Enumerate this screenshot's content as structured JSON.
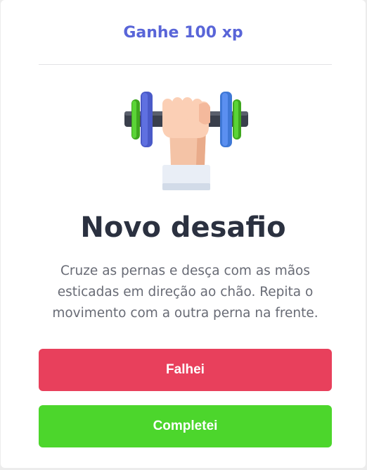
{
  "challenge": {
    "xp_label": "Ganhe 100 xp",
    "icon": "dumbbell-lift-icon",
    "title": "Novo desafio",
    "description": "Cruze as pernas e desça com as mãos esticadas em direção ao chão. Repita o movimento com a outra perna na frente."
  },
  "actions": {
    "fail_label": "Falhei",
    "complete_label": "Completei"
  },
  "colors": {
    "accent": "#5965d8",
    "title": "#2b3140",
    "body_text": "#686b75",
    "fail": "#e8405c",
    "success": "#4cd62c",
    "card": "#ffffff",
    "background": "#ececec"
  }
}
